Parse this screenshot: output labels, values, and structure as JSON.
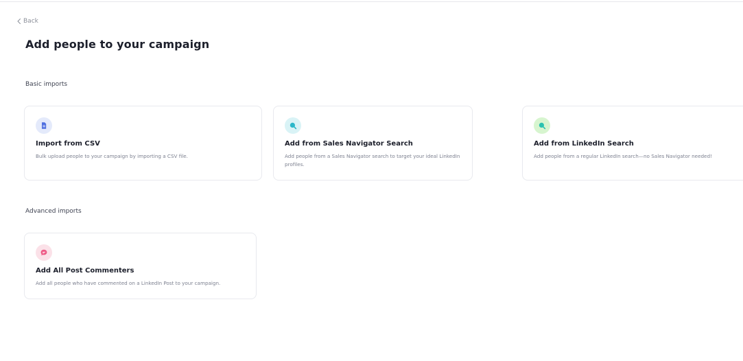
{
  "nav": {
    "back_label": "Back"
  },
  "page": {
    "title": "Add people to your campaign"
  },
  "sections": {
    "basic": {
      "label": "Basic imports",
      "cards": [
        {
          "title": "Import from CSV",
          "description": "Bulk upload people to your campaign by importing a CSV file.",
          "icon": "file-icon",
          "icon_bg": "#e4eafb",
          "icon_color": "#4f6fe0"
        },
        {
          "title": "Add from Sales Navigator Search",
          "description": "Add people from a Sales Navigator search to target your ideal LinkedIn profiles.",
          "icon": "search-icon",
          "icon_bg": "#d9f3f6",
          "icon_color": "#2bb7c9"
        },
        {
          "title": "Add from LinkedIn Search",
          "description": "Add people from a regular LinkedIn search—no Sales Navigator needed!",
          "icon": "search-icon",
          "icon_bg": "#d7f5cf",
          "icon_color": "#2bc2b0"
        }
      ]
    },
    "advanced": {
      "label": "Advanced imports",
      "cards": [
        {
          "title": "Add All Post Commenters",
          "description": "Add all people who have commented on a LinkedIn Post to your campaign.",
          "icon": "comment-icon",
          "icon_bg": "#fbe1e8",
          "icon_color": "#ee5a86"
        }
      ]
    }
  }
}
